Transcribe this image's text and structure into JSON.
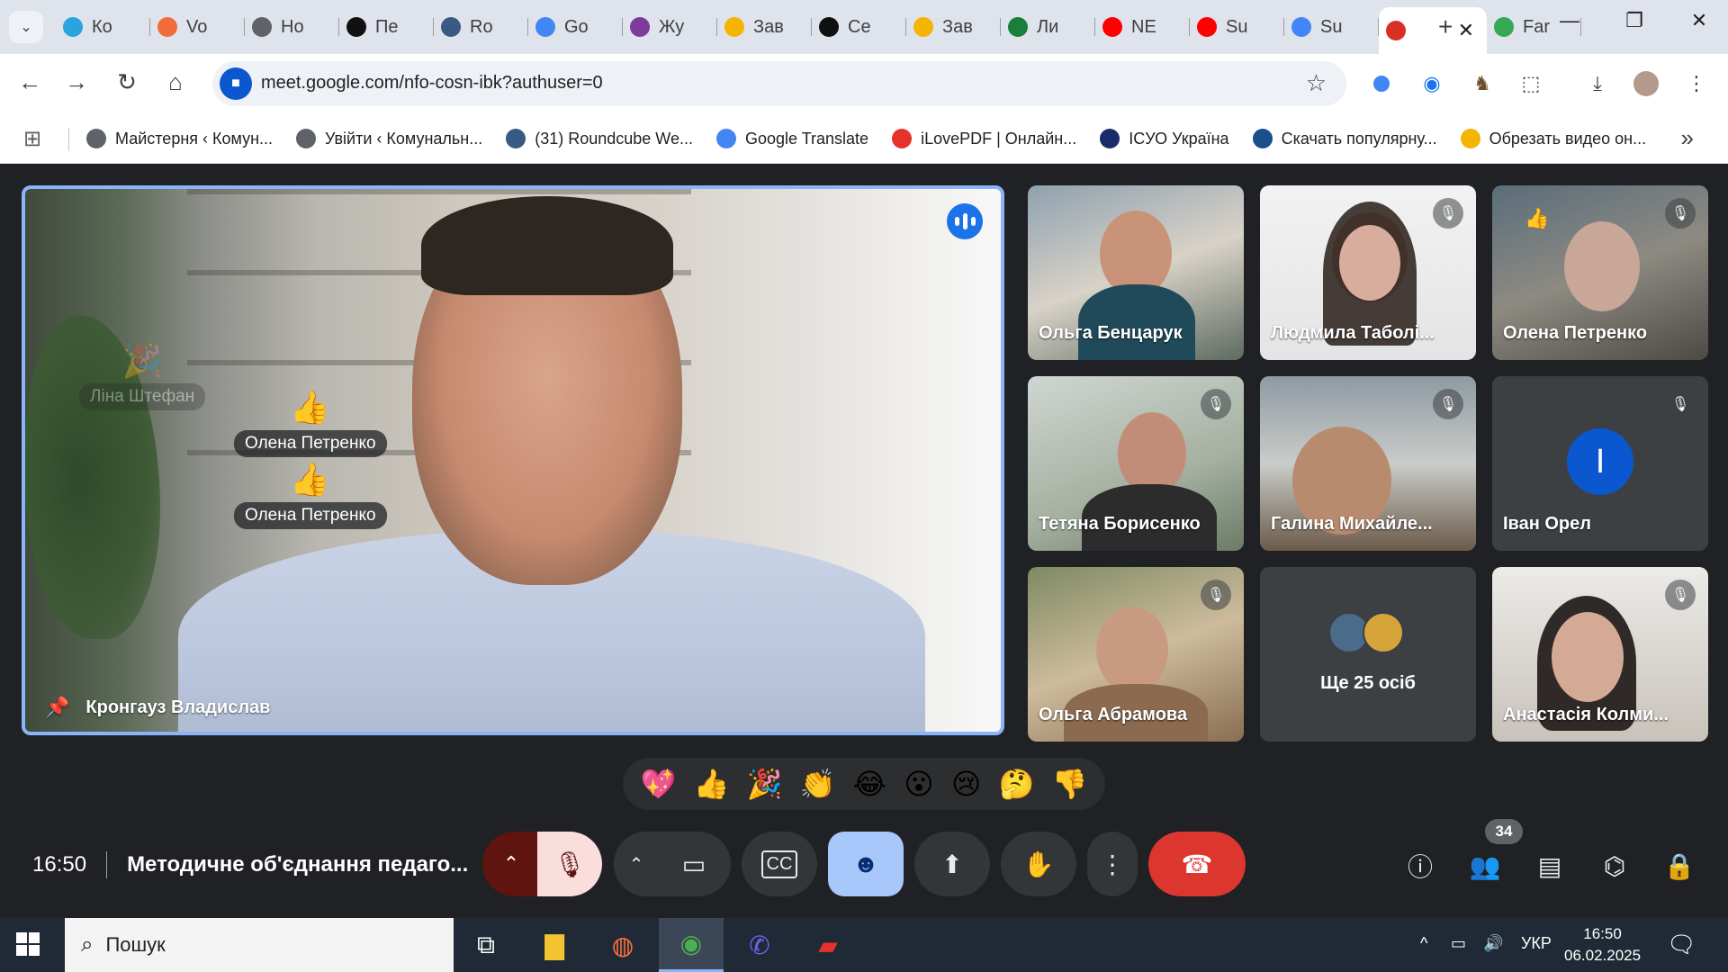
{
  "browser": {
    "tabs": [
      {
        "title": "Ко",
        "icon": "telegram-icon",
        "color": "#2aa3df"
      },
      {
        "title": "Vo",
        "icon": "voice-icon",
        "color": "#f26b3a"
      },
      {
        "title": "Но",
        "icon": "globe-icon",
        "color": "#5f6368"
      },
      {
        "title": "Пе",
        "icon": "chatgpt-icon",
        "color": "#111111"
      },
      {
        "title": "Ro",
        "icon": "roundcube-icon",
        "color": "#3a5a86"
      },
      {
        "title": "Go",
        "icon": "google-translate-icon",
        "color": "#4285f4"
      },
      {
        "title": "Жу",
        "icon": "journal-icon",
        "color": "#7c3a9c"
      },
      {
        "title": "Зав",
        "icon": "classroom-icon",
        "color": "#f5b400"
      },
      {
        "title": "Се",
        "icon": "clapper-icon",
        "color": "#111111"
      },
      {
        "title": "Зав",
        "icon": "classroom-icon",
        "color": "#f5b400"
      },
      {
        "title": "Ли",
        "icon": "sheets-plus-icon",
        "color": "#188038"
      },
      {
        "title": "NE",
        "icon": "youtube-icon",
        "color": "#ff0000"
      },
      {
        "title": "Su",
        "icon": "youtube-icon",
        "color": "#ff0000"
      },
      {
        "title": "Su",
        "icon": "google-icon",
        "color": "#4285f4"
      }
    ],
    "active_tab": {
      "title": "",
      "icon": "meet-record-icon",
      "color": "#d93025",
      "close": "✕"
    },
    "extra_tab": {
      "title": "Far",
      "icon": "family-icon",
      "color": "#34a853"
    },
    "new_tab": "+",
    "window": {
      "minimize": "—",
      "restore": "❐",
      "close": "✕"
    },
    "url": "meet.google.com/nfo-cosn-ibk?authuser=0",
    "bookmarks": [
      {
        "label": "Майстерня ‹ Комун...",
        "color": "#5f6368"
      },
      {
        "label": "Увійти ‹ Комунальн...",
        "color": "#5f6368"
      },
      {
        "label": "(31) Roundcube We...",
        "color": "#3a5a86"
      },
      {
        "label": "Google Translate",
        "color": "#4285f4"
      },
      {
        "label": "iLovePDF | Онлайн...",
        "color": "#e5322d"
      },
      {
        "label": "ICУО Україна",
        "color": "#1a2b6b"
      },
      {
        "label": "Скачать популярну...",
        "color": "#1a4f8b"
      },
      {
        "label": "Обрезать видео он...",
        "color": "#f4b400"
      }
    ],
    "bookmarks_more": "»"
  },
  "meeting": {
    "main_speaker": "Кронгауз Владислав",
    "reactions": [
      {
        "emoji": "🎉",
        "name": "Ліна Штефан"
      },
      {
        "emoji": "👍",
        "name": "Олена Петренко"
      },
      {
        "emoji": "👍",
        "name": "Олена Петренко"
      }
    ],
    "participants": [
      {
        "name": "Ольга Бенцарук",
        "muted": false
      },
      {
        "name": "Людмила Таболі...",
        "muted": true
      },
      {
        "name": "Олена Петренко",
        "muted": true,
        "hand": "👍"
      },
      {
        "name": "Тетяна Борисенко",
        "muted": true
      },
      {
        "name": "Галина Михайле...",
        "muted": true
      },
      {
        "name": "Іван Орел",
        "muted": true,
        "initial": "І"
      },
      {
        "name": "Ольга Абрамова",
        "muted": true
      },
      {
        "name": "Ще 25 осіб",
        "muted": false
      },
      {
        "name": "Анастасія Колми...",
        "muted": true
      }
    ],
    "reaction_bar": [
      "💖",
      "👍",
      "🎉",
      "👏",
      "😂",
      "😮",
      "😢",
      "🤔",
      "👎"
    ],
    "time": "16:50",
    "title": "Методичне об'єднання педаго...",
    "people_count": "34",
    "colors": {
      "leave": "#dc362e",
      "mic_off": "#f9dedc",
      "emoji_active": "#a8c7fa",
      "speaker_border": "#8ab4f8"
    }
  },
  "taskbar": {
    "search_placeholder": "Пошук",
    "lang": "УКР",
    "time": "16:50",
    "date": "06.02.2025"
  }
}
